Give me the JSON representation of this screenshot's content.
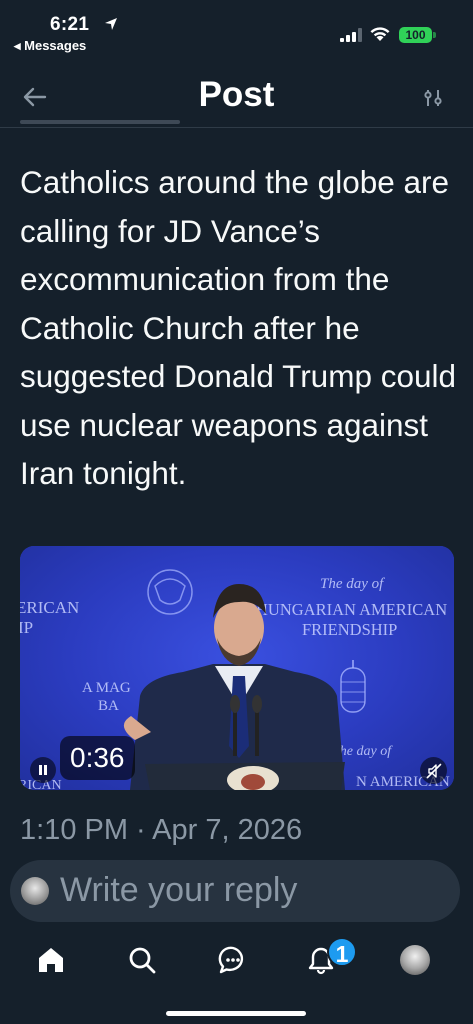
{
  "status_bar": {
    "time": "6:21",
    "back_app": "◂ Messages",
    "battery": "100",
    "icons": [
      "location-arrow-icon",
      "signal-icon",
      "wifi-icon",
      "battery-icon"
    ]
  },
  "header": {
    "title": "Post",
    "back_icon": "arrow-left-icon",
    "filter_icon": "sliders-icon"
  },
  "post": {
    "text": "Catholics around the globe are calling for JD Vance’s excommunication from the Catholic Church after he suggested Donald Trump could use nuclear weapons against Iran tonight.",
    "timestamp": "1:10 PM · Apr 7, 2026"
  },
  "video": {
    "duration": "0:36",
    "pause_icon": "pause-icon",
    "mute_icon": "speaker-muted-icon",
    "backdrop": {
      "left_top": "ERICAN",
      "left_second": "IP",
      "day_of_top": "The day of",
      "banner_line1": "HUNGARIAN AMERICAN",
      "banner_line2": "FRIENDSHIP",
      "left_mid1": "A MAG",
      "left_mid2": "BA",
      "day_of_bottom": "The day of",
      "bottom_right": "N AMERICAN",
      "bottom_left": "RICAN"
    }
  },
  "reply": {
    "placeholder": "Write your reply"
  },
  "tab_bar": {
    "items": [
      "home-icon",
      "search-icon",
      "chat-bubble-icon",
      "bell-icon",
      "profile-avatar"
    ],
    "notification_count": "1"
  },
  "colors": {
    "background": "#15202b",
    "accent": "#1d9bf0",
    "secondary_text": "#8b98a5",
    "reply_bar": "#273340",
    "battery": "#30d158",
    "video_backdrop": "#2d3fc1"
  }
}
